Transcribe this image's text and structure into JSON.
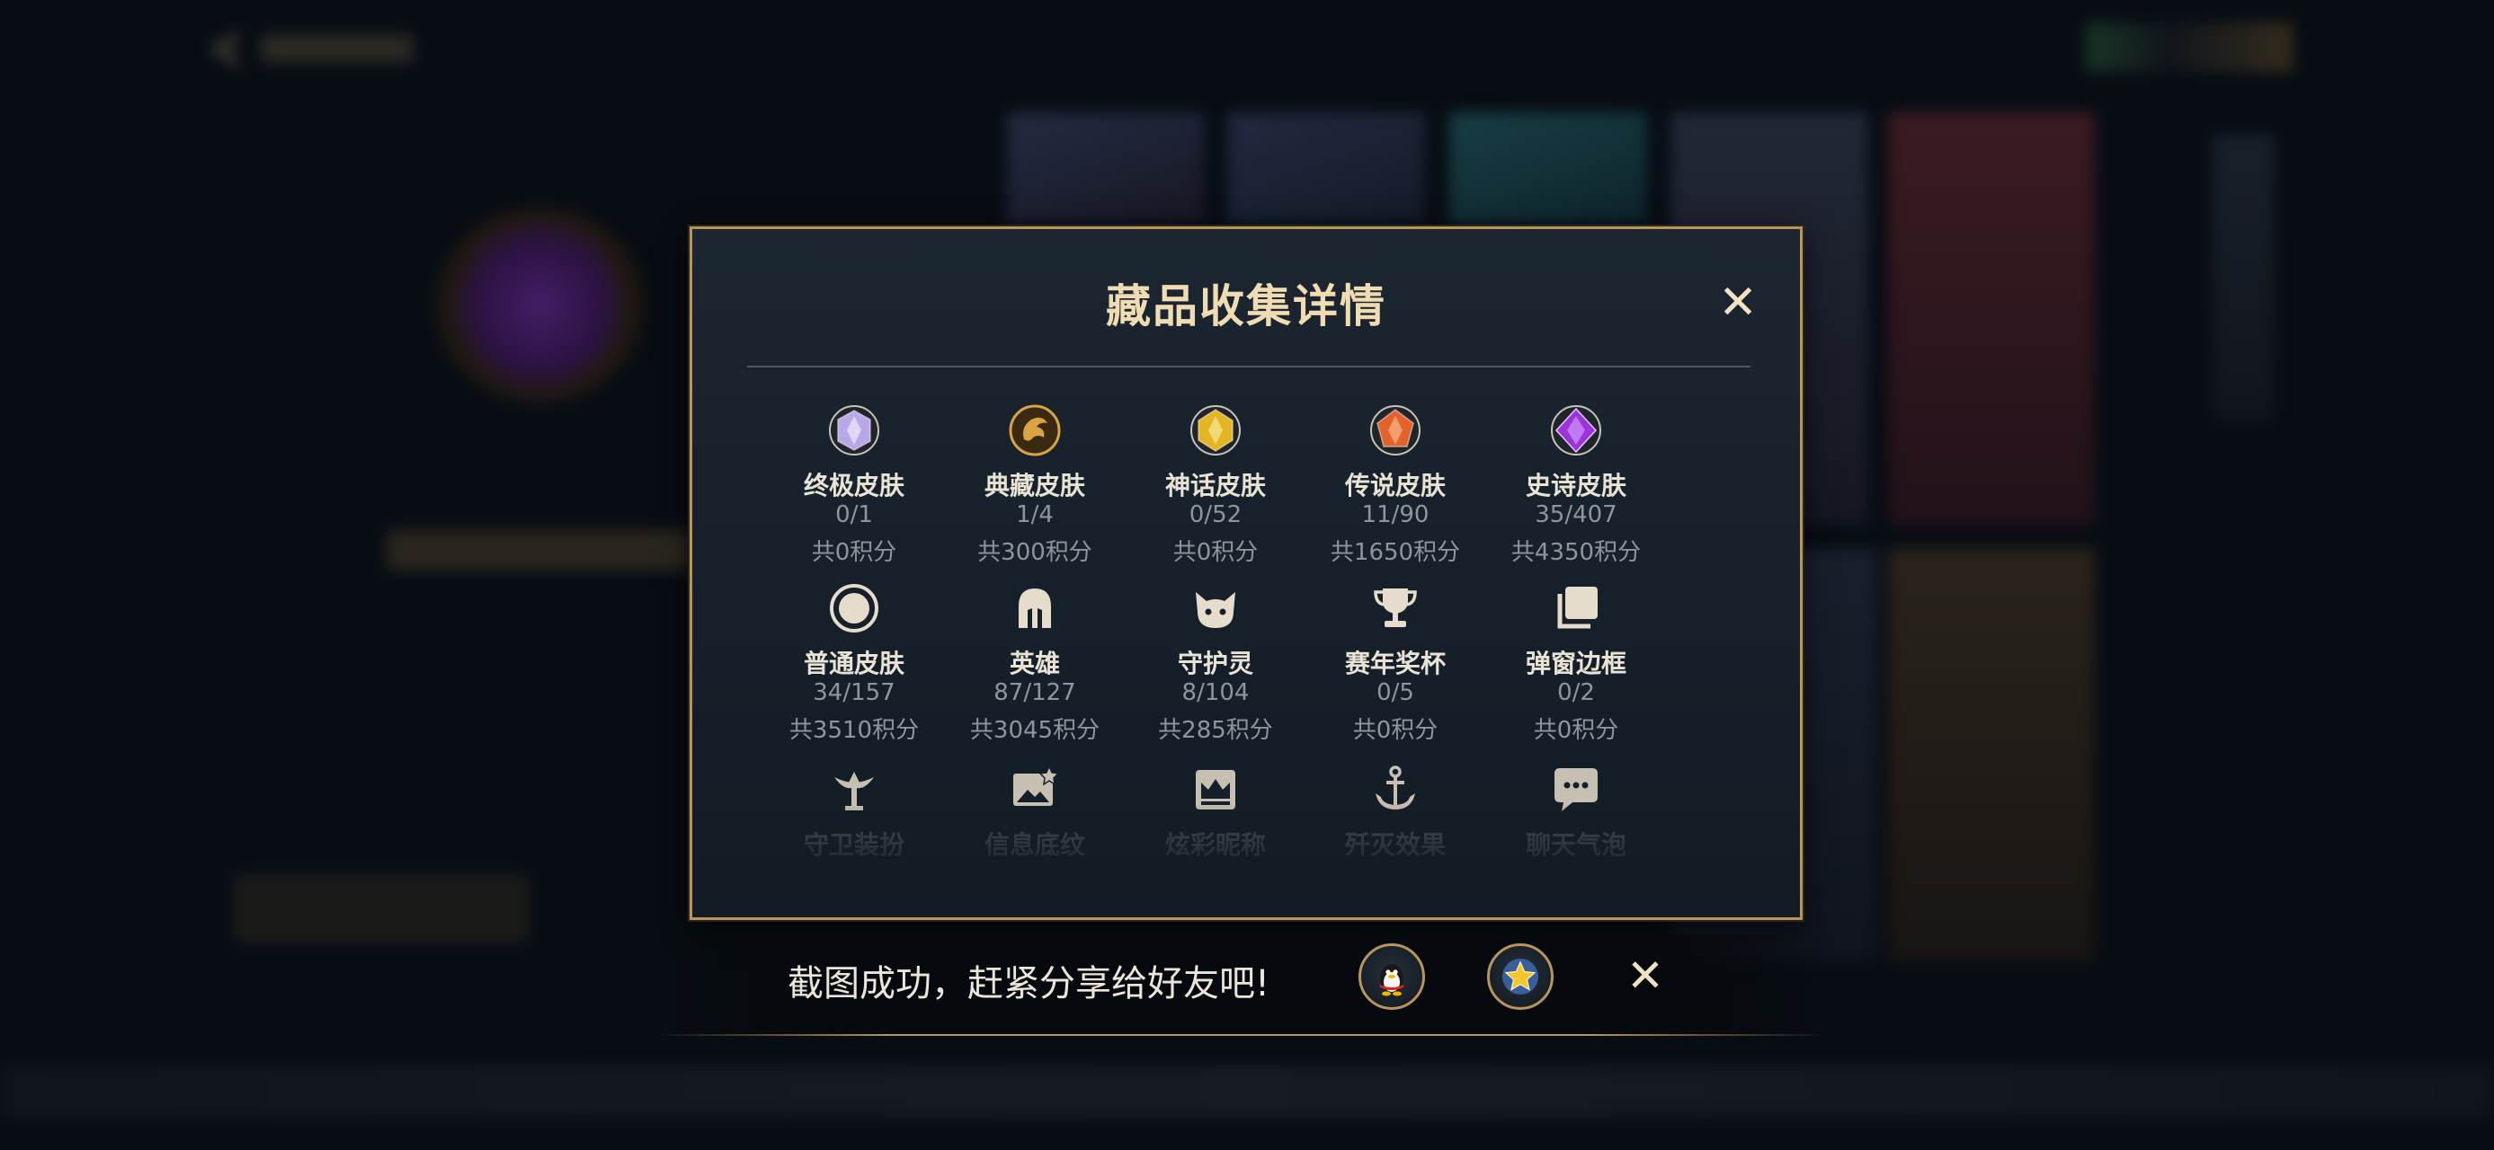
{
  "dialog": {
    "title": "藏品收集详情",
    "close_icon": "close-icon"
  },
  "categories": [
    {
      "name": "终极皮肤",
      "count": "0/1",
      "points": "共0积分",
      "icon": "ultimate-skin-icon",
      "color": "#b9a7e6"
    },
    {
      "name": "典藏皮肤",
      "count": "1/4",
      "points": "共300积分",
      "icon": "collector-skin-icon",
      "color": "#d9a441"
    },
    {
      "name": "神话皮肤",
      "count": "0/52",
      "points": "共0积分",
      "icon": "mythic-skin-icon",
      "color": "#e4b522"
    },
    {
      "name": "传说皮肤",
      "count": "11/90",
      "points": "共1650积分",
      "icon": "legend-skin-icon",
      "color": "#e2622a"
    },
    {
      "name": "史诗皮肤",
      "count": "35/407",
      "points": "共4350积分",
      "icon": "epic-skin-icon",
      "color": "#9b34d9"
    },
    {
      "name": "普通皮肤",
      "count": "34/157",
      "points": "共3510积分",
      "icon": "normal-skin-icon",
      "color": "#e6dccb"
    },
    {
      "name": "英雄",
      "count": "87/127",
      "points": "共3045积分",
      "icon": "hero-helmet-icon",
      "color": "#e6dccb"
    },
    {
      "name": "守护灵",
      "count": "8/104",
      "points": "共285积分",
      "icon": "guardian-spirit-icon",
      "color": "#e6dccb"
    },
    {
      "name": "赛年奖杯",
      "count": "0/5",
      "points": "共0积分",
      "icon": "trophy-icon",
      "color": "#e6dccb"
    },
    {
      "name": "弹窗边框",
      "count": "0/2",
      "points": "共0积分",
      "icon": "popup-frame-icon",
      "color": "#e6dccb"
    },
    {
      "name": "守卫装扮",
      "icon": "ward-skin-icon",
      "color": "#e6dccb",
      "faded": true
    },
    {
      "name": "信息底纹",
      "icon": "info-background-icon",
      "color": "#e6dccb",
      "faded": true
    },
    {
      "name": "炫彩昵称",
      "icon": "colorful-nickname-icon",
      "color": "#e6dccb",
      "faded": true
    },
    {
      "name": "歼灭效果",
      "icon": "annihilation-effect-icon",
      "color": "#e6dccb",
      "faded": true
    },
    {
      "name": "聊天气泡",
      "icon": "chat-bubble-icon",
      "color": "#e6dccb",
      "faded": true
    }
  ],
  "toast": {
    "text": "截图成功，赶紧分享给好友吧!",
    "share_qq_icon": "qq-penguin-icon",
    "share_favorite_icon": "star-icon",
    "close_icon": "close-icon"
  },
  "colors": {
    "accent_gold": "#b8955a",
    "title_color": "#f0dcb3",
    "dialog_bg": "#16202a",
    "page_bg": "#0b1119"
  }
}
